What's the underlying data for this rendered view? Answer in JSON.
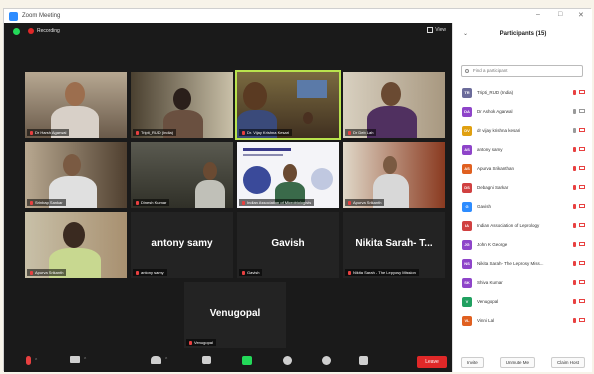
{
  "window": {
    "title": "Zoom Meeting"
  },
  "topbar": {
    "recording_label": "Recording",
    "view_label": "View"
  },
  "tiles": [
    {
      "name": "Dr Harsh Agarwal",
      "big": ""
    },
    {
      "name": "Tripti_RUD (India)",
      "big": ""
    },
    {
      "name": "Dr. Vijay Krishna Kesari",
      "big": ""
    },
    {
      "name": "Dr Deb Lah",
      "big": ""
    },
    {
      "name": "Srinbap Sankar",
      "big": ""
    },
    {
      "name": "Dinesh Kumar",
      "big": ""
    },
    {
      "name": "Indian Association of Microbiologists",
      "big": ""
    },
    {
      "name": "Apurva Srikanth",
      "big": ""
    },
    {
      "name": "Apurva Srikanth",
      "big": ""
    },
    {
      "name": "antony samy",
      "big": "antony samy"
    },
    {
      "name": "Gavish",
      "big": "Gavish"
    },
    {
      "name": "Nikita Sarah - The Lepyosy Mission",
      "big": "Nikita Sarah- T..."
    },
    {
      "name": "Venugopal",
      "big": "Venugopal"
    }
  ],
  "toolbar": {
    "items": [
      "mute",
      "video",
      "participants",
      "chat",
      "share",
      "record",
      "reactions",
      "apps"
    ],
    "end_label": "Leave"
  },
  "panel": {
    "title": "Participants (15)",
    "search_placeholder": "Find a participant",
    "participants": [
      {
        "initials": "TR",
        "name": "Tripti_RUD (India)",
        "color": "#6b6b9a",
        "mic": false,
        "cam": false
      },
      {
        "initials": "DA",
        "name": "Dr Ashok Agarwal",
        "color": "#8e44c9",
        "mic": true,
        "cam": true
      },
      {
        "initials": "DV",
        "name": "dr vijay krishna kesari",
        "color": "#e0a010",
        "mic": true,
        "cam": false
      },
      {
        "initials": "AS",
        "name": "antony samy",
        "color": "#8e44c9",
        "mic": false,
        "cam": false
      },
      {
        "initials": "AS",
        "name": "Apurva Srikanthan",
        "color": "#e06020",
        "mic": false,
        "cam": false
      },
      {
        "initials": "DS",
        "name": "Debagni Sarkar",
        "color": "#d04040",
        "mic": false,
        "cam": false
      },
      {
        "initials": "G",
        "name": "Gavish",
        "color": "#2d8cff",
        "mic": false,
        "cam": false
      },
      {
        "initials": "IA",
        "name": "Indian Association of Leprology",
        "color": "#d04040",
        "mic": false,
        "cam": false
      },
      {
        "initials": "JG",
        "name": "John K George",
        "color": "#8e44c9",
        "mic": false,
        "cam": false
      },
      {
        "initials": "NS",
        "name": "Nikita Sarah- The Leprosy Miss...",
        "color": "#8e44c9",
        "mic": false,
        "cam": false
      },
      {
        "initials": "SK",
        "name": "Shiva Kumar",
        "color": "#8e44c9",
        "mic": false,
        "cam": false
      },
      {
        "initials": "V",
        "name": "Venugopal",
        "color": "#20a060",
        "mic": false,
        "cam": false
      },
      {
        "initials": "VL",
        "name": "Vinni Lal",
        "color": "#e06020",
        "mic": false,
        "cam": false
      }
    ],
    "footer": {
      "invite": "Invite",
      "unmute_me": "Unmute Me",
      "claim_host": "Claim Host"
    }
  }
}
